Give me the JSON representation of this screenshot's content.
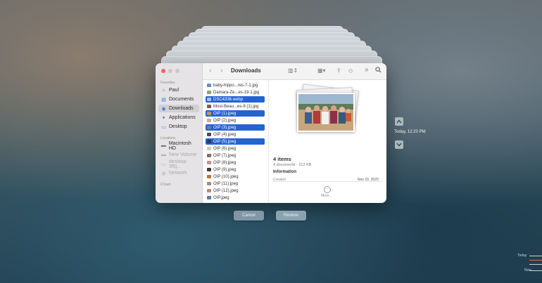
{
  "window": {
    "folder_title": "Downloads",
    "traffic_lights": [
      "#fd5f57",
      "#c9c9c9",
      "#c9c9c9"
    ]
  },
  "sidebar": {
    "favorites_heading": "Favorites",
    "favorites": [
      {
        "label": "Paul",
        "icon": "home-icon"
      },
      {
        "label": "Documents",
        "icon": "document-icon"
      },
      {
        "label": "Downloads",
        "icon": "download-icon",
        "selected": true
      },
      {
        "label": "Applications",
        "icon": "applications-icon"
      },
      {
        "label": "Desktop",
        "icon": "desktop-icon"
      }
    ],
    "locations_heading": "Locations",
    "locations": [
      {
        "label": "Macintosh HD",
        "icon": "disk-icon"
      },
      {
        "label": "New Volume",
        "icon": "disk-icon",
        "dim": true
      },
      {
        "label": "desktop-3f5j...",
        "icon": "computer-icon",
        "dim": true
      },
      {
        "label": "Network",
        "icon": "network-icon",
        "dim": true
      }
    ],
    "icloud_heading": "iCloud"
  },
  "toolbar": {
    "back": "‹",
    "forward": "›",
    "view_icon": "columns-view-icon",
    "group_icon": "group-icon",
    "share_icon": "share-icon",
    "tag_icon": "tag-icon",
    "more_icon": "»",
    "search_icon": "search-icon"
  },
  "files": [
    {
      "name": "baby-hippo...res-7-1.jpg",
      "selected": false,
      "color": "#6f8fa7"
    },
    {
      "name": "Damara-Ze...es-19-1.jpg",
      "selected": false,
      "color": "#93a36b"
    },
    {
      "name": "DSC4336.webp",
      "selected": true,
      "color": "#a8c4e8"
    },
    {
      "name": "Most-Beau...es-9 (1).jpg",
      "selected": false,
      "color": "#7c5a4a"
    },
    {
      "name": "OIP (1).jpeg",
      "selected": true,
      "color": "#c98f5c"
    },
    {
      "name": "OIP (2).jpeg",
      "selected": false,
      "color": "#c9b184"
    },
    {
      "name": "OIP (3).jpeg",
      "selected": true,
      "color": "#5f7fa8"
    },
    {
      "name": "OIP (4).jpeg",
      "selected": false,
      "color": "#4b4b4b"
    },
    {
      "name": "OIP (5).jpeg",
      "selected": true,
      "color": "#2b3b5a"
    },
    {
      "name": "OIP (6).jpeg",
      "selected": false,
      "color": "#c9c9c9"
    },
    {
      "name": "OIP (7).jpeg",
      "selected": false,
      "color": "#8a6e5a"
    },
    {
      "name": "OIP (8).jpeg",
      "selected": false,
      "color": "#d48a8a"
    },
    {
      "name": "OIP (9).jpeg",
      "selected": false,
      "color": "#3a3a3a"
    },
    {
      "name": "OIP (10).jpeg",
      "selected": false,
      "color": "#b8763a"
    },
    {
      "name": "OIP (11).jpeg",
      "selected": false,
      "color": "#a08e7e"
    },
    {
      "name": "OIP (12).jpeg",
      "selected": false,
      "color": "#b48d76"
    },
    {
      "name": "OIP.jpeg",
      "selected": false,
      "color": "#5d7a95"
    }
  ],
  "preview": {
    "items_count": "4 items",
    "summary": "4 documents - 212 KB",
    "info_heading": "Information",
    "created_label": "Created",
    "created_value": "Nov 23, 2020",
    "more_label": "More..."
  },
  "buttons": {
    "cancel": "Cancel",
    "restore": "Restore"
  },
  "time_machine": {
    "current_label": "Today, 12:20 PM",
    "timeline_today": "Today",
    "timeline_now": "Now"
  }
}
